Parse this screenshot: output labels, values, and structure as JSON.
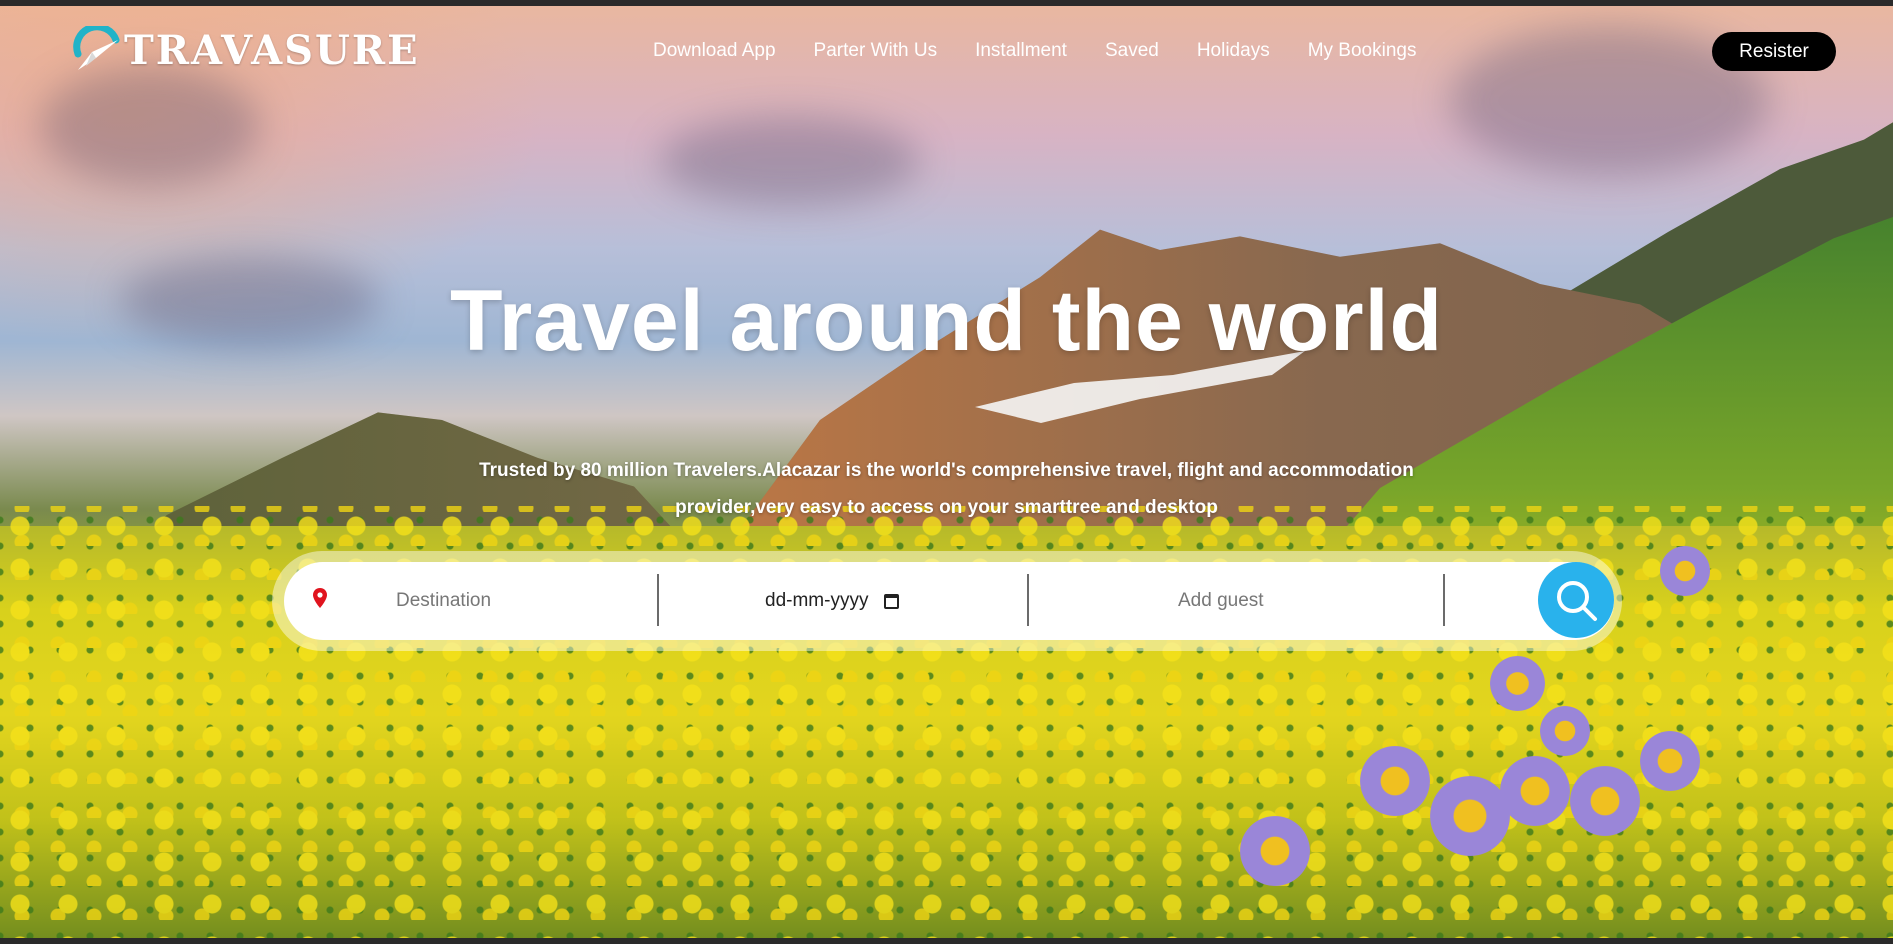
{
  "brand": {
    "name": "TRAVASURE",
    "logo_icon": "globe-plane-icon"
  },
  "nav": {
    "items": [
      {
        "label": "Download App"
      },
      {
        "label": "Parter With Us"
      },
      {
        "label": "Installment"
      },
      {
        "label": "Saved"
      },
      {
        "label": "Holidays"
      },
      {
        "label": "My Bookings"
      }
    ],
    "register_label": "Resister"
  },
  "hero": {
    "title": "Travel around the world",
    "subtitle_line1": "Trusted by 80 million Travelers.Alacazar is the world's comprehensive travel, flight and accommodation",
    "subtitle_line2": "provider,very easy to access on your smarttree and desktop"
  },
  "search": {
    "destination_placeholder": "Destination",
    "date_placeholder": "dd-mm-yyyy",
    "guest_placeholder": "Add guest",
    "accent_color": "#29b2ec",
    "pin_color": "#e0141e"
  }
}
